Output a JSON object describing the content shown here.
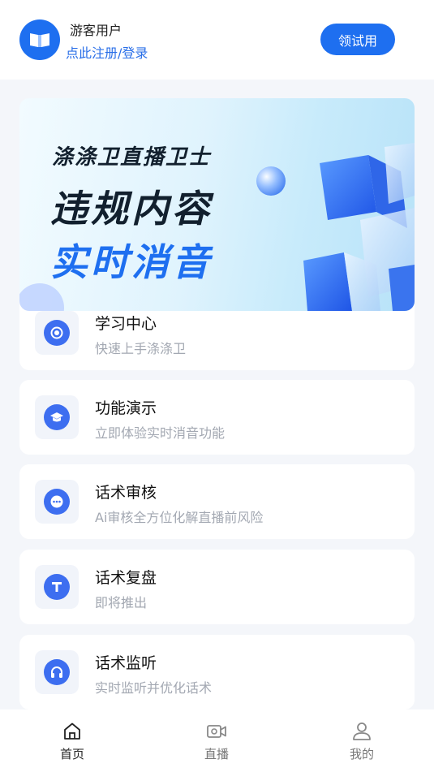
{
  "header": {
    "user_name": "游客用户",
    "login_link": "点此注册/登录",
    "trial_button": "领试用"
  },
  "banner": {
    "line1": "涤涤卫直播卫士",
    "line2": "违规内容",
    "line3": "实时消音"
  },
  "features": [
    {
      "title": "学习中心",
      "subtitle": "快速上手涤涤卫",
      "icon": "record-icon"
    },
    {
      "title": "功能演示",
      "subtitle": "立即体验实时消音功能",
      "icon": "graduation-cap-icon"
    },
    {
      "title": "话术审核",
      "subtitle": "Ai审核全方位化解直播前风险",
      "icon": "chat-bubble-icon"
    },
    {
      "title": "话术复盘",
      "subtitle": "即将推出",
      "icon": "text-t-icon"
    },
    {
      "title": "话术监听",
      "subtitle": "实时监听并优化话术",
      "icon": "headphones-icon"
    }
  ],
  "tabbar": {
    "items": [
      {
        "label": "首页",
        "icon": "home-icon",
        "active": true
      },
      {
        "label": "直播",
        "icon": "video-camera-icon",
        "active": false
      },
      {
        "label": "我的",
        "icon": "user-icon",
        "active": false
      }
    ]
  },
  "colors": {
    "accent": "#1e6ff0",
    "muted": "#a3a8b2"
  }
}
